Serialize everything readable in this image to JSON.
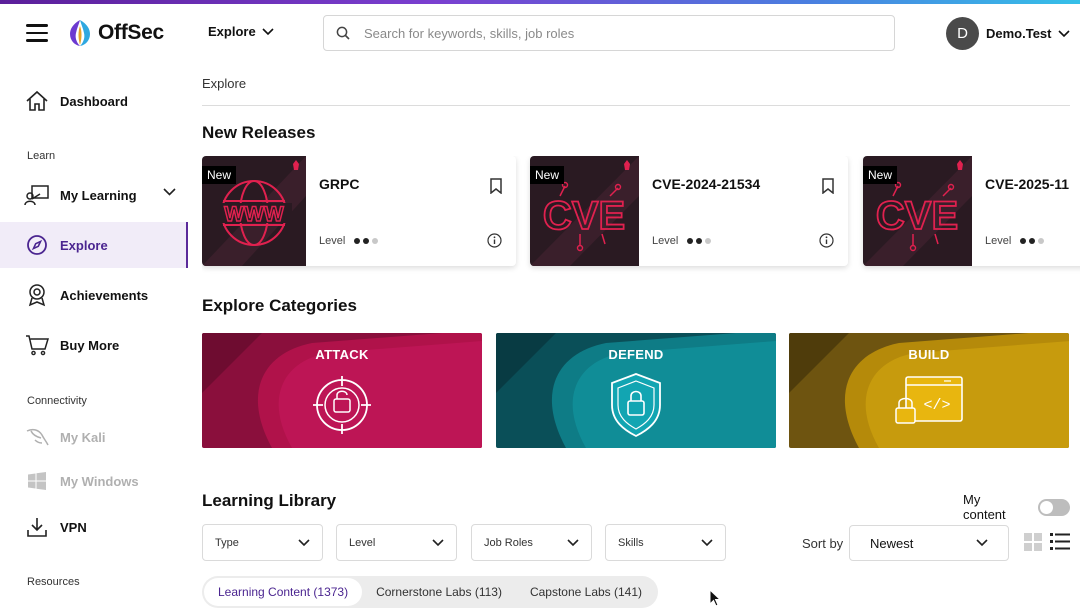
{
  "app": {
    "logo_text": "OffSec"
  },
  "header": {
    "explore_label": "Explore",
    "search_placeholder": "Search for keywords, skills, job roles",
    "user": {
      "initial": "D",
      "name": "Demo.Test"
    }
  },
  "sidebar": {
    "dashboard": "Dashboard",
    "section_learn": "Learn",
    "my_learning": "My Learning",
    "explore": "Explore",
    "achievements": "Achievements",
    "buy_more": "Buy More",
    "section_connectivity": "Connectivity",
    "my_kali": "My Kali",
    "my_windows": "My Windows",
    "vpn": "VPN",
    "section_resources": "Resources"
  },
  "main": {
    "breadcrumb": "Explore",
    "new_releases_title": "New Releases",
    "releases": [
      {
        "badge": "New",
        "title": "GRPC",
        "level_label": "Level",
        "thumb_text": "WWW"
      },
      {
        "badge": "New",
        "title": "CVE-2024-21534",
        "level_label": "Level",
        "thumb_text": "CVE"
      },
      {
        "badge": "New",
        "title": "CVE-2025-11",
        "level_label": "Level",
        "thumb_text": "CVE"
      }
    ],
    "categories_title": "Explore Categories",
    "categories": [
      {
        "label": "ATTACK",
        "color": "#b0124a"
      },
      {
        "label": "DEFEND",
        "color": "#0e7c86"
      },
      {
        "label": "BUILD",
        "color": "#c99a07"
      }
    ],
    "library_title": "Learning Library",
    "my_content_label": "My content",
    "filters": [
      "Type",
      "Level",
      "Job Roles",
      "Skills"
    ],
    "sort_label": "Sort by",
    "sort_value": "Newest",
    "tabs": [
      "Learning Content (1373)",
      "Cornerstone Labs (113)",
      "Capstone Labs (141)"
    ]
  },
  "colors": {
    "accent": "#4b2590",
    "attack": "#b0124a",
    "defend": "#0e7c86",
    "build": "#c99a07"
  }
}
